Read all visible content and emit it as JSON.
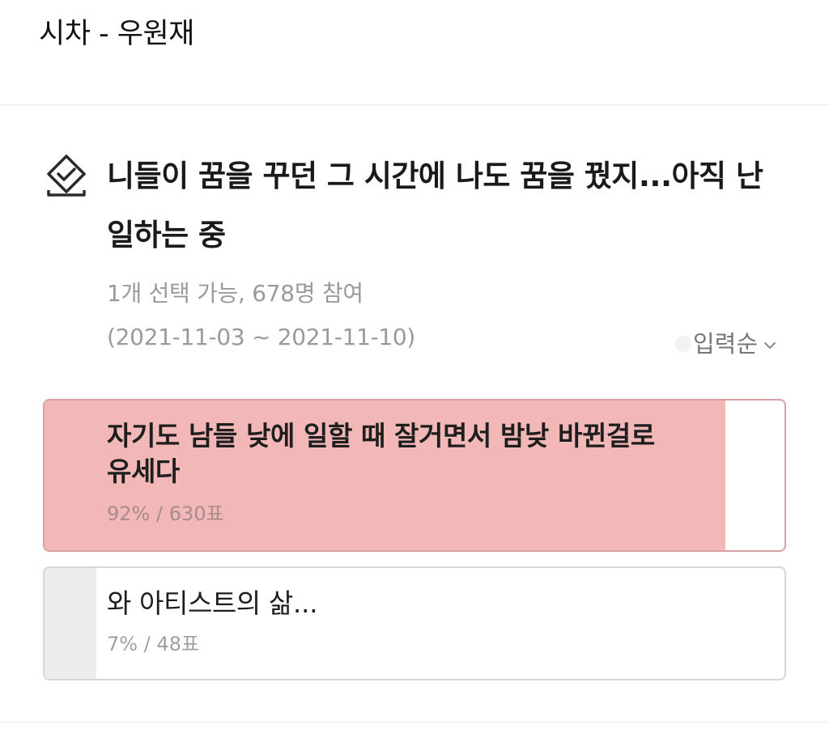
{
  "header": {
    "title": "시차 - 우원재"
  },
  "poll": {
    "icon": "vote-box-check-icon",
    "title": "니들이 꿈을 꾸던 그 시간에 나도 꿈을 꿨지...아직 난 일하는 중",
    "meta": "1개 선택 가능, 678명 참여",
    "period": "(2021-11-03 ~ 2021-11-10)",
    "sort": {
      "label": "입력순",
      "icon": "chevron-down-icon"
    },
    "options": [
      {
        "text": "자기도 남들 낮에 일할 때 잘거면서 밤낮 바뀐걸로 유세다",
        "result": "92% / 630표",
        "percent": 92,
        "votes": 630,
        "fill_color": "#f2b8b8",
        "selected": true
      },
      {
        "text": "와 아티스트의 삶...",
        "result": "7% / 48표",
        "percent": 7,
        "votes": 48,
        "fill_color": "#ececec",
        "selected": false
      }
    ]
  }
}
